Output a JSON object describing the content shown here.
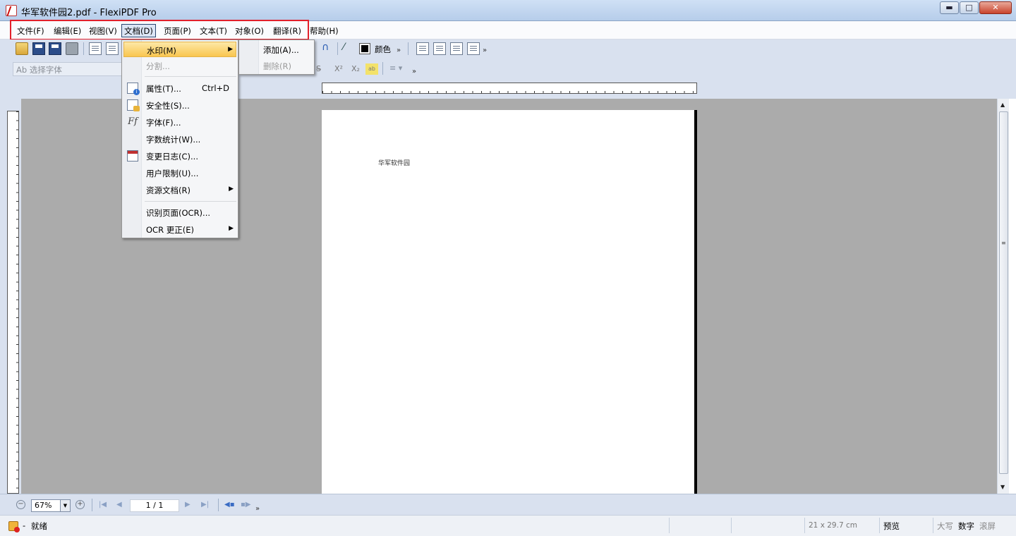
{
  "window": {
    "title": "华军软件园2.pdf - FlexiPDF Pro",
    "buttons": {
      "minimize": "▬",
      "maximize": "□",
      "close": "✕"
    }
  },
  "menubar": {
    "items": [
      {
        "label": "文件(F)"
      },
      {
        "label": "编辑(E)"
      },
      {
        "label": "视图(V)"
      },
      {
        "label": "文档(D)",
        "active": true
      },
      {
        "label": "页面(P)"
      },
      {
        "label": "文本(T)"
      },
      {
        "label": "对象(O)"
      },
      {
        "label": "翻译(R)"
      },
      {
        "label": "帮助(H)"
      }
    ]
  },
  "toolbar": {
    "font_placeholder": "Ab 选择字体",
    "color_label": "颜色",
    "overflow": "»"
  },
  "document_menu": {
    "items": [
      {
        "label": "水印(M)",
        "submenu": true,
        "hover": true
      },
      {
        "label": "分割...",
        "disabled": true
      },
      {
        "label": "属性(T)...",
        "shortcut": "Ctrl+D",
        "icon": "properties-icon"
      },
      {
        "label": "安全性(S)...",
        "icon": "security-icon"
      },
      {
        "label": "字体(F)...",
        "icon": "font-icon",
        "icon_text": "Ff"
      },
      {
        "label": "字数统计(W)..."
      },
      {
        "label": "变更日志(C)...",
        "icon": "calendar-icon"
      },
      {
        "label": "用户限制(U)..."
      },
      {
        "label": "资源文档(R)",
        "submenu": true
      },
      {
        "label": "识别页面(OCR)..."
      },
      {
        "label": "OCR 更正(E)",
        "submenu": true
      }
    ],
    "submenu_arrow": "▶"
  },
  "watermark_submenu": {
    "items": [
      {
        "label": "添加(A)..."
      },
      {
        "label": "删除(R)",
        "disabled": true
      }
    ]
  },
  "document": {
    "page_text": "华军软件园"
  },
  "navbar": {
    "zoom_value": "67%",
    "page_indicator": "1 / 1"
  },
  "statusbar": {
    "status": "就绪",
    "page_size": "21 x 29.7 cm",
    "mode": "预览",
    "caps": "大写",
    "num": "数字",
    "scroll": "滚屏"
  },
  "colors": {
    "highlight": "#e2202b",
    "menu_hover": "#f9c64f",
    "workspace": "#ababab"
  }
}
